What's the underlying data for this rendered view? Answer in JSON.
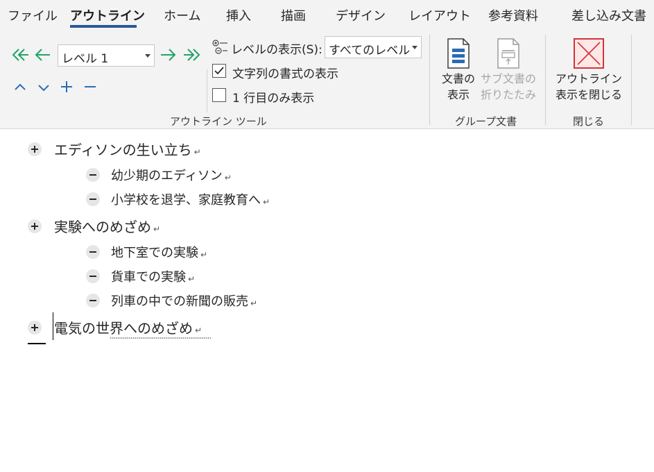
{
  "tabs": [
    {
      "label": "ファイル",
      "active": false
    },
    {
      "label": "アウトライン",
      "active": true
    },
    {
      "label": "ホーム",
      "active": false
    },
    {
      "label": "挿入",
      "active": false
    },
    {
      "label": "描画",
      "active": false
    },
    {
      "label": "デザイン",
      "active": false
    },
    {
      "label": "レイアウト",
      "active": false
    },
    {
      "label": "参考資料",
      "active": false
    },
    {
      "label": "差し込み文書",
      "active": false
    }
  ],
  "outline_tools": {
    "level_value": "レベル 1",
    "show_level_label": "レベルの表示(S):",
    "show_level_value": "すべてのレベル",
    "show_text_formatting_label": "文字列の書式の表示",
    "show_text_formatting_checked": true,
    "show_first_line_only_label": "1 行目のみ表示",
    "show_first_line_only_checked": false,
    "group_label": "アウトライン ツール",
    "icons": {
      "promote_to_heading": "double-arrow-left-icon",
      "promote": "arrow-left-icon",
      "demote": "arrow-right-icon",
      "demote_to_body": "double-arrow-right-icon",
      "move_up": "chevron-up-icon",
      "move_down": "chevron-down-icon",
      "expand": "plus-icon",
      "collapse": "minus-icon"
    },
    "accent_color": "#21a366",
    "blue_color": "#2b6cb5"
  },
  "master_document": {
    "show_document_label_1": "文書の",
    "show_document_label_2": "表示",
    "collapse_subdocs_label_1": "サブ文書の",
    "collapse_subdocs_label_2": "折りたたみ",
    "group_label": "グループ文書"
  },
  "close": {
    "close_outline_label_1": "アウトライン",
    "close_outline_label_2": "表示を閉じる",
    "group_label": "閉じる",
    "close_color": "#d13438"
  },
  "outline": [
    {
      "level": 1,
      "symbol": "plus",
      "text": "エディソンの生い立ち"
    },
    {
      "level": 2,
      "symbol": "minus",
      "text": "幼少期のエディソン"
    },
    {
      "level": 2,
      "symbol": "minus",
      "text": "小学校を退学、家庭教育へ"
    },
    {
      "level": 1,
      "symbol": "plus",
      "text": "実験へのめざめ"
    },
    {
      "level": 2,
      "symbol": "minus",
      "text": "地下室での実験"
    },
    {
      "level": 2,
      "symbol": "minus",
      "text": "貨車での実験"
    },
    {
      "level": 2,
      "symbol": "minus",
      "text": "列車の中での新聞の販売"
    },
    {
      "level": 1,
      "symbol": "plus",
      "text": "電気の世界へのめざめ"
    }
  ],
  "paragraph_mark": "↵"
}
